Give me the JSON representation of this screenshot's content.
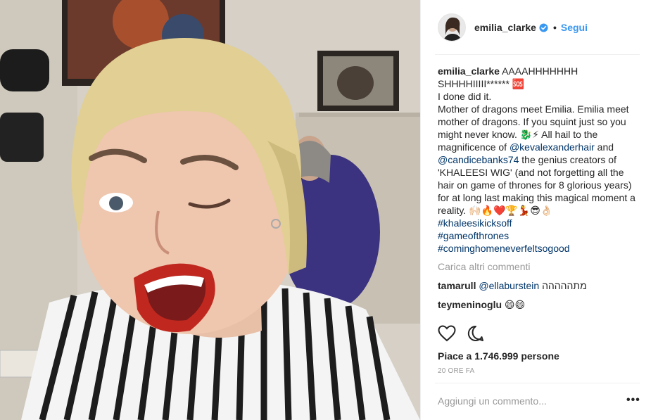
{
  "post": {
    "username": "emilia_clarke",
    "follow_label": "Segui",
    "separator": "•",
    "caption_text": "AAAAHHHHHHH SHHHHIIIII****** 🆘\nI done did it.\nMother of dragons meet Emilia. Emilia meet mother of dragons. If you squint just so you might never know. 🐉⚡ All hail to the magnificence of ",
    "mention1": "@kevalexanderhair",
    "caption_and": " and ",
    "mention2": "@candicebanks74",
    "caption_text2": " the genius creators of 'KHALEESI WIG' (and not forgetting all the hair on game of thrones for 8 glorious years) for at long last making this magical moment a reality. 🙌🏻🔥❤️🏆💃😎👌🏻",
    "hashtag1": "#khaleesikicksoff",
    "hashtag2": "#gameofthrones",
    "hashtag3": "#cominghomeneverfeltsogood",
    "load_more": "Carica altri commenti",
    "comments": [
      {
        "user": "tamarull",
        "mention": "@ellaburstein",
        "text": " מתההההה"
      },
      {
        "user": "teymeninoglu",
        "text": " 😄😄"
      }
    ],
    "likes": "Piace a 1.746.999 persone",
    "time": "20 ORE FA",
    "add_comment_placeholder": "Aggiungi un commento...",
    "more_options": "•••"
  },
  "icons": [
    "verified-badge-icon",
    "heart-icon",
    "comment-icon",
    "more-options-icon"
  ],
  "colors": {
    "link": "#003569",
    "follow": "#3897f0",
    "verified": "#3897f0",
    "muted": "#999999"
  }
}
